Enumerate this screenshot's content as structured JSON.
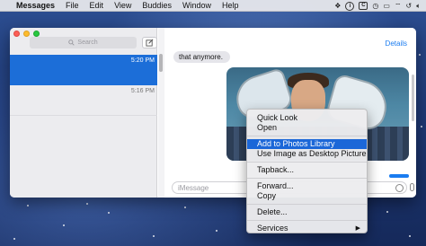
{
  "menubar": {
    "app_name": "Messages",
    "items": [
      "File",
      "Edit",
      "View",
      "Buddies",
      "Window",
      "Help"
    ],
    "status_icons": [
      "dropbox-icon",
      "info-circle-icon",
      "c-box-icon",
      "time-machine-icon",
      "airplay-icon",
      "wifi-icon",
      "history-icon",
      "volume-icon"
    ],
    "status_text": {
      "info": "i",
      "c": "C"
    }
  },
  "sidebar": {
    "search_placeholder": "Search",
    "conversations": [
      {
        "time": "5:20 PM",
        "selected": true
      },
      {
        "time": "5:16 PM",
        "selected": false
      }
    ]
  },
  "transcript": {
    "details_label": "Details",
    "incoming_message": "that anymore.",
    "input_placeholder": "iMessage"
  },
  "context_menu": {
    "items": [
      {
        "label": "Quick Look"
      },
      {
        "label": "Open"
      },
      {
        "label": "Add to Photos Library",
        "highlighted": true
      },
      {
        "label": "Use Image as Desktop Picture"
      },
      {
        "label": "Tapback..."
      },
      {
        "label": "Forward..."
      },
      {
        "label": "Copy"
      },
      {
        "label": "Delete..."
      },
      {
        "label": "Services",
        "submenu": true
      }
    ],
    "submenu_arrow": "▶"
  },
  "colors": {
    "selection_blue": "#1c6ed8",
    "menu_highlight": "#1b67d8",
    "link_blue": "#1a7cf0"
  }
}
